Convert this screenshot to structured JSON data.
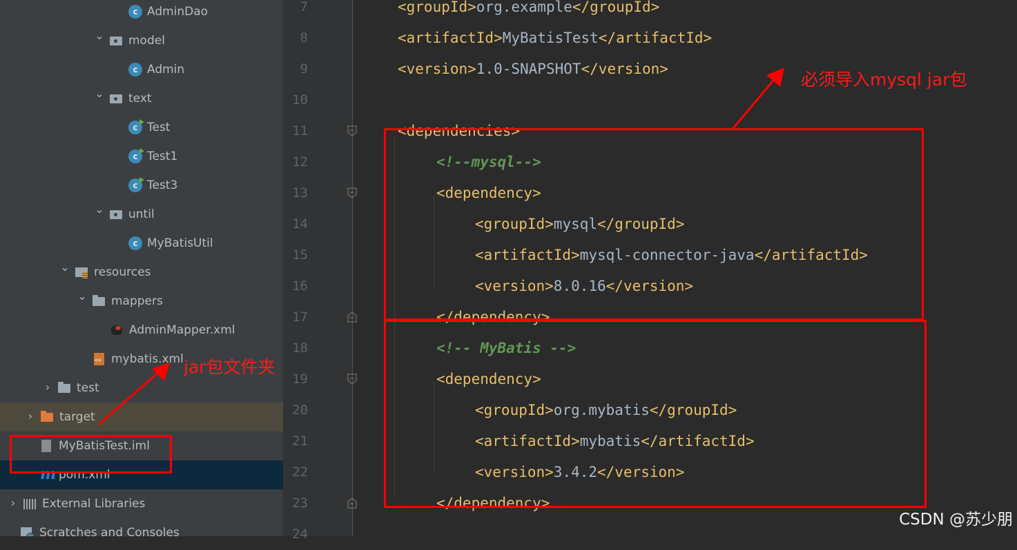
{
  "project_tree": {
    "items": [
      {
        "label": "AdminDao",
        "icon": "class-icon"
      },
      {
        "label": "model",
        "icon": "package-icon",
        "expanded": true
      },
      {
        "label": "Admin",
        "icon": "class-icon"
      },
      {
        "label": "text",
        "icon": "package-icon",
        "expanded": true
      },
      {
        "label": "Test",
        "icon": "runnable-class-icon"
      },
      {
        "label": "Test1",
        "icon": "runnable-class-icon"
      },
      {
        "label": "Test3",
        "icon": "runnable-class-icon"
      },
      {
        "label": "until",
        "icon": "package-icon",
        "expanded": true
      },
      {
        "label": "MyBatisUtil",
        "icon": "class-icon"
      },
      {
        "label": "resources",
        "icon": "resources-folder-icon",
        "expanded": true
      },
      {
        "label": "mappers",
        "icon": "folder-icon",
        "expanded": true
      },
      {
        "label": "AdminMapper.xml",
        "icon": "mybatis-xml-icon"
      },
      {
        "label": "mybatis.xml",
        "icon": "xml-file-icon"
      },
      {
        "label": "test",
        "icon": "folder-icon",
        "expanded": false
      },
      {
        "label": "target",
        "icon": "excluded-folder-icon",
        "expanded": false
      },
      {
        "label": "MyBatisTest.iml",
        "icon": "iml-file-icon"
      },
      {
        "label": "pom.xml",
        "icon": "maven-icon",
        "selected": true
      },
      {
        "label": "External Libraries",
        "icon": "libraries-icon",
        "expanded": false
      },
      {
        "label": "Scratches and Consoles",
        "icon": "scratches-icon"
      }
    ]
  },
  "editor": {
    "lines": [
      {
        "num": "7",
        "indent": 0,
        "parts": [
          {
            "t": "<groupId>",
            "c": "tag"
          },
          {
            "t": "org.example",
            "c": "txt"
          },
          {
            "t": "</groupId>",
            "c": "tag"
          }
        ]
      },
      {
        "num": "8",
        "indent": 0,
        "parts": [
          {
            "t": "<artifactId>",
            "c": "tag"
          },
          {
            "t": "MyBatisTest",
            "c": "txt"
          },
          {
            "t": "</artifactId>",
            "c": "tag"
          }
        ]
      },
      {
        "num": "9",
        "indent": 0,
        "parts": [
          {
            "t": "<version>",
            "c": "tag"
          },
          {
            "t": "1.0-SNAPSHOT",
            "c": "txt"
          },
          {
            "t": "</version>",
            "c": "tag"
          }
        ]
      },
      {
        "num": "10",
        "indent": 0,
        "parts": []
      },
      {
        "num": "11",
        "indent": 0,
        "fold": "open",
        "parts": [
          {
            "t": "<dependencies>",
            "c": "tag"
          }
        ]
      },
      {
        "num": "12",
        "indent": 1,
        "parts": [
          {
            "t": "<!--mysql-->",
            "c": "cmt"
          }
        ]
      },
      {
        "num": "13",
        "indent": 1,
        "fold": "open",
        "parts": [
          {
            "t": "<dependency>",
            "c": "tag"
          }
        ]
      },
      {
        "num": "14",
        "indent": 2,
        "parts": [
          {
            "t": "<groupId>",
            "c": "tag"
          },
          {
            "t": "mysql",
            "c": "txt"
          },
          {
            "t": "</groupId>",
            "c": "tag"
          }
        ]
      },
      {
        "num": "15",
        "indent": 2,
        "parts": [
          {
            "t": "<artifactId>",
            "c": "tag"
          },
          {
            "t": "mysql-connector-java",
            "c": "txt"
          },
          {
            "t": "</artifactId>",
            "c": "tag"
          }
        ]
      },
      {
        "num": "16",
        "indent": 2,
        "parts": [
          {
            "t": "<version>",
            "c": "tag"
          },
          {
            "t": "8.0.16",
            "c": "txt"
          },
          {
            "t": "</version>",
            "c": "tag"
          }
        ]
      },
      {
        "num": "17",
        "indent": 1,
        "fold": "close",
        "parts": [
          {
            "t": "</dependency>",
            "c": "tag"
          }
        ]
      },
      {
        "num": "18",
        "indent": 1,
        "parts": [
          {
            "t": "<!-- MyBatis -->",
            "c": "cmt"
          }
        ]
      },
      {
        "num": "19",
        "indent": 1,
        "fold": "open",
        "parts": [
          {
            "t": "<dependency>",
            "c": "tag"
          }
        ]
      },
      {
        "num": "20",
        "indent": 2,
        "parts": [
          {
            "t": "<groupId>",
            "c": "tag"
          },
          {
            "t": "org.mybatis",
            "c": "txt"
          },
          {
            "t": "</groupId>",
            "c": "tag"
          }
        ]
      },
      {
        "num": "21",
        "indent": 2,
        "parts": [
          {
            "t": "<artifactId>",
            "c": "tag"
          },
          {
            "t": "mybatis",
            "c": "txt"
          },
          {
            "t": "</artifactId>",
            "c": "tag"
          }
        ]
      },
      {
        "num": "22",
        "indent": 2,
        "parts": [
          {
            "t": "<version>",
            "c": "tag"
          },
          {
            "t": "3.4.2",
            "c": "txt"
          },
          {
            "t": "</version>",
            "c": "tag"
          }
        ]
      },
      {
        "num": "23",
        "indent": 1,
        "fold": "close",
        "parts": [
          {
            "t": "</dependency>",
            "c": "tag"
          }
        ]
      },
      {
        "num": "24",
        "indent": 0,
        "parts": []
      }
    ]
  },
  "annotations": {
    "mysql_note": "必须导入mysql jar包",
    "jar_folder_note": "jar包文件夹",
    "color": "#ff0000"
  },
  "watermark": "CSDN @苏少朋",
  "colors": {
    "tag": "#e8bf6a",
    "text": "#a9b7c6",
    "comment": "#629755",
    "line_number": "#606366",
    "editor_bg": "#2b2b2b",
    "tree_bg": "#3c3f41",
    "selection": "#0d293e"
  }
}
